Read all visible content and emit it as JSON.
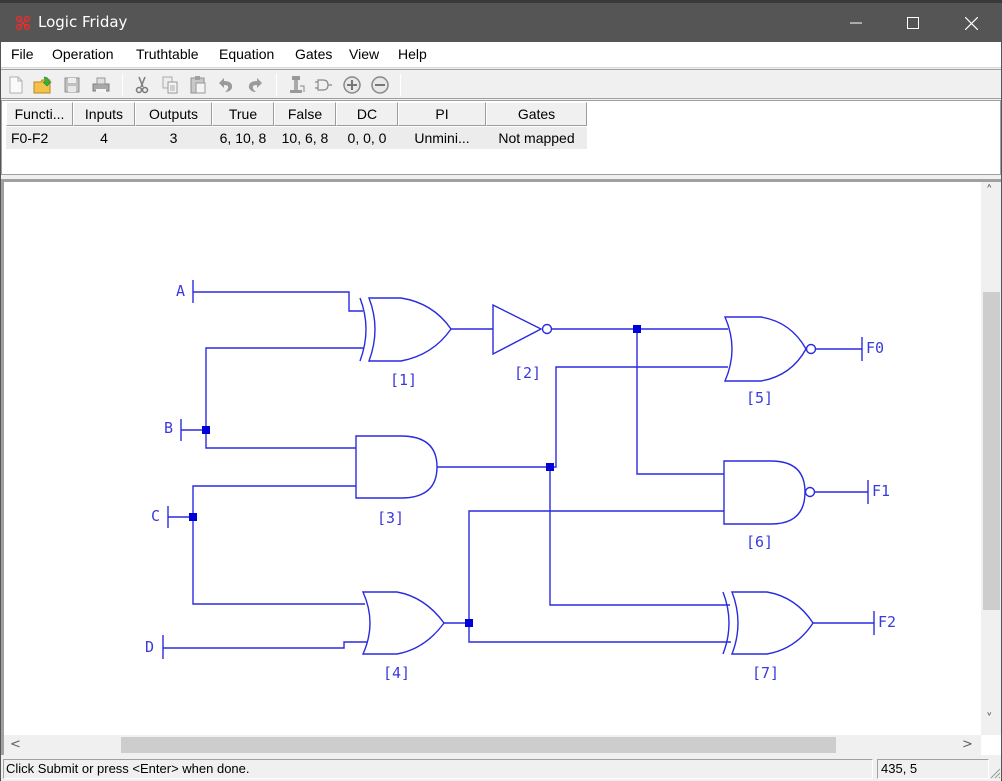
{
  "window": {
    "title": "Logic Friday",
    "controls": {
      "minimize": "—",
      "maximize": "☐",
      "close": "✕"
    }
  },
  "menu": [
    "File",
    "Operation",
    "Truthtable",
    "Equation",
    "Gates",
    "View",
    "Help"
  ],
  "toolbar": {
    "icons": [
      "new-file-icon",
      "open-folder-icon",
      "save-icon",
      "print-icon",
      "cut-icon",
      "copy-icon",
      "paste-icon",
      "undo-icon",
      "redo-icon",
      "minimize-tool-icon",
      "gate-icon",
      "zoom-in-icon",
      "zoom-out-icon"
    ]
  },
  "functions_table": {
    "headers": [
      "Functi...",
      "Inputs",
      "Outputs",
      "True",
      "False",
      "DC",
      "PI",
      "Gates"
    ],
    "rows": [
      [
        "F0-F2",
        "4",
        "3",
        "6, 10, 8",
        "10, 6, 8",
        "0, 0, 0",
        "Unmini...",
        "Not mapped"
      ]
    ]
  },
  "circuit": {
    "wire_color": "#2a2ae0",
    "label_color": "#3a3adc",
    "inputs": [
      "A",
      "B",
      "C",
      "D"
    ],
    "outputs": [
      "F0",
      "F1",
      "F2"
    ],
    "gates": [
      {
        "id": "[1]",
        "type": "XOR"
      },
      {
        "id": "[2]",
        "type": "NOT"
      },
      {
        "id": "[3]",
        "type": "AND"
      },
      {
        "id": "[4]",
        "type": "OR"
      },
      {
        "id": "[5]",
        "type": "NOR"
      },
      {
        "id": "[6]",
        "type": "NAND"
      },
      {
        "id": "[7]",
        "type": "XOR"
      }
    ]
  },
  "scroll": {
    "up": "˄",
    "down": "˅",
    "left": "<",
    "right": ">"
  },
  "status": {
    "message": "Click Submit or press <Enter> when done.",
    "coords": "435, 5"
  }
}
